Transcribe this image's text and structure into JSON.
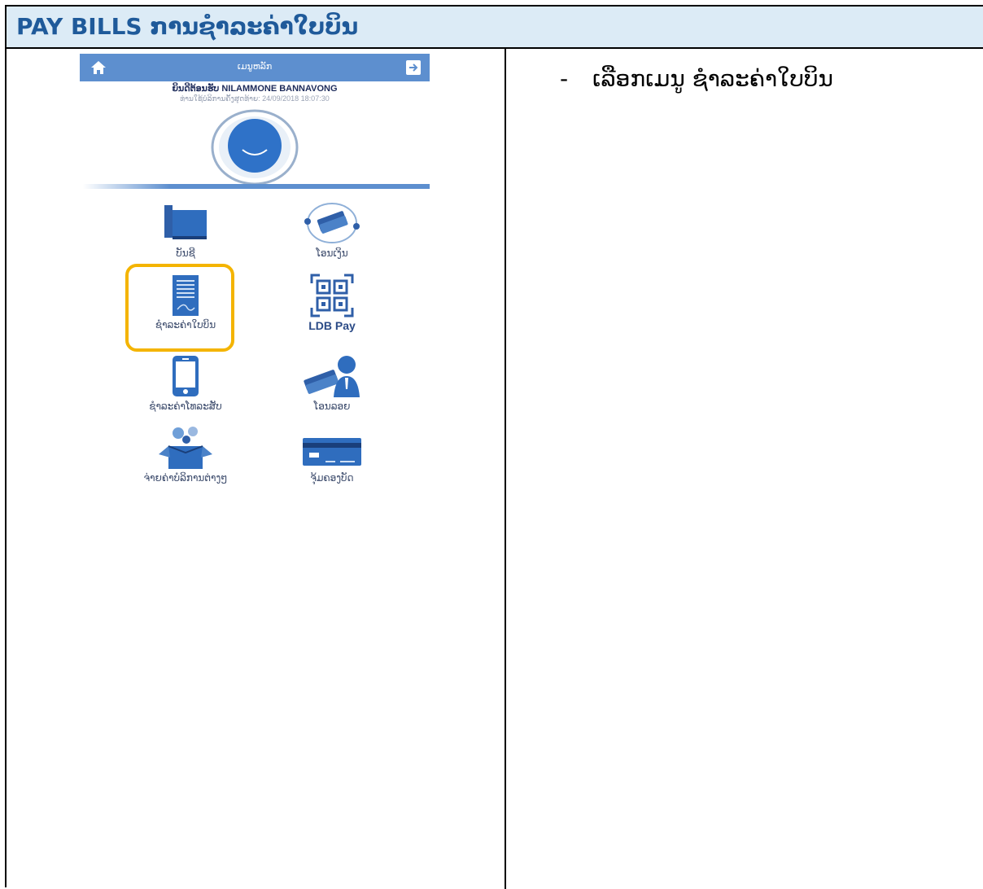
{
  "document": {
    "title": "PAY BILLS ການຊຳລະຄ່າໃບບິນ",
    "instruction_bullet": "-",
    "instruction": "ເລືອກເມນູ ຊຳລະຄ່າໃບບິນ"
  },
  "app": {
    "header_title": "ເມນູຫລັກ",
    "welcome": "ຍິນດີຕ້ອນຮັບ NILAMMONE BANNAVONG",
    "last_login": "ທ່ານໃຊ້ບໍລິການຄັ້ງສຸດທ້າຍ: 24/09/2018 18:07:30",
    "icons": {
      "home": "home-icon",
      "exit": "exit-icon",
      "avatar": "smile-avatar-icon"
    },
    "menu": [
      {
        "label": "ບັນຊີ",
        "icon": "account-book-icon"
      },
      {
        "label": "ໂອນເງິນ",
        "icon": "transfer-money-icon"
      },
      {
        "label": "ຊຳລະຄ່າໃບບິນ",
        "icon": "bill-receipt-icon",
        "highlighted": true
      },
      {
        "label": "LDB Pay",
        "icon": "qr-code-icon"
      },
      {
        "label": "ຊຳລະຄ່າໂທລະສັບ",
        "icon": "mobile-phone-icon"
      },
      {
        "label": "ໂອນລອຍ",
        "icon": "remittance-person-icon"
      },
      {
        "label": "ຈ່າຍຄ່າບໍລິການຕ່າງໆ",
        "icon": "services-box-icon"
      },
      {
        "label": "ຈຸ້ມຄອງບັດ",
        "icon": "card-manage-icon"
      }
    ],
    "colors": {
      "primary": "#5d8fcf",
      "highlight": "#f4b400",
      "title_text": "#1f5a9a",
      "title_bg": "#dcebf6"
    }
  }
}
